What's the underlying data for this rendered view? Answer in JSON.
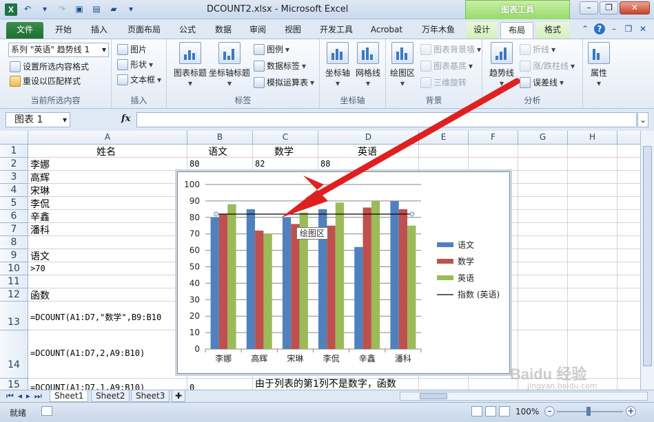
{
  "titlebar": {
    "app_icon": "X",
    "title": "DCOUNT2.xlsx - Microsoft Excel",
    "context_header": "图表工具"
  },
  "tabs": [
    {
      "label": "文件"
    },
    {
      "label": "开始"
    },
    {
      "label": "插入"
    },
    {
      "label": "页面布局"
    },
    {
      "label": "公式"
    },
    {
      "label": "数据"
    },
    {
      "label": "审阅"
    },
    {
      "label": "视图"
    },
    {
      "label": "开发工具"
    },
    {
      "label": "Acrobat"
    },
    {
      "label": "万年木鱼"
    },
    {
      "label": "设计"
    },
    {
      "label": "布局"
    },
    {
      "label": "格式"
    }
  ],
  "ribbon": {
    "current_selection": {
      "selector_value": "系列 \"英语\" 趋势线 1",
      "format_selection": "设置所选内容格式",
      "reset_style": "重设以匹配样式",
      "label": "当前所选内容"
    },
    "insert": {
      "picture": "图片",
      "shapes": "形状",
      "textbox": "文本框",
      "label": "插入"
    },
    "labels": {
      "chart_title": "图表标题",
      "axis_titles": "坐标轴标题",
      "legend": "图例",
      "data_labels": "数据标签",
      "data_table": "模拟运算表",
      "label": "标签"
    },
    "axes": {
      "axes": "坐标轴",
      "gridlines": "网格线",
      "label": "坐标轴"
    },
    "background": {
      "plot_area": "绘图区",
      "chart_wall": "图表背景墙",
      "chart_floor": "图表基底",
      "rotation": "三维旋转",
      "label": "背景"
    },
    "analysis": {
      "trendline": "趋势线",
      "lines": "折线",
      "updown_bars": "涨/跌柱线",
      "error_bars": "误差线",
      "label": "分析"
    },
    "properties": {
      "label": "属性"
    }
  },
  "formula_bar": {
    "name_box": "图表 1",
    "fx": "fx",
    "formula": ""
  },
  "columns": [
    "A",
    "B",
    "C",
    "D",
    "E",
    "F",
    "G",
    "H"
  ],
  "rows": [
    "1",
    "2",
    "3",
    "4",
    "5",
    "6",
    "7",
    "8",
    "9",
    "10",
    "11",
    "12",
    "13",
    "14",
    "15"
  ],
  "cells": {
    "A1": "姓名",
    "B1": "语文",
    "C1": "数学",
    "D1": "英语",
    "A2": "李娜",
    "B2": "80",
    "C2": "82",
    "D2": "88",
    "A3": "高辉",
    "A4": "宋琳",
    "A5": "李侃",
    "A6": "辛鑫",
    "A7": "潘科",
    "A9": "语文",
    "A10": ">70",
    "A12": "函数",
    "A13": "=DCOUNT(A1:D7,\"数学\",B9:B10",
    "A14": "=DCOUNT(A1:D7,2,A9:B10)",
    "A15": "=DCOUNT(A1:D7,1,A9:B10)",
    "B15": "0",
    "C15": "由于列表的第1列不是数字，函数"
  },
  "chart_data": {
    "type": "bar",
    "categories": [
      "李娜",
      "高辉",
      "宋琳",
      "李侃",
      "辛鑫",
      "潘科"
    ],
    "series": [
      {
        "name": "语文",
        "values": [
          80,
          85,
          80,
          85,
          62,
          90
        ],
        "color": "#4f81bd"
      },
      {
        "name": "数学",
        "values": [
          82,
          72,
          76,
          75,
          86,
          85
        ],
        "color": "#c0504d"
      },
      {
        "name": "英语",
        "values": [
          88,
          70,
          83,
          89,
          90,
          75
        ],
        "color": "#9bbb59"
      }
    ],
    "trendline": {
      "name": "指数 (英语)",
      "value": 82,
      "color": "#000000"
    },
    "ylim": [
      0,
      100
    ],
    "yticks": [
      0,
      10,
      20,
      30,
      40,
      50,
      60,
      70,
      80,
      90,
      100
    ],
    "grid": true,
    "legend_position": "right"
  },
  "tooltip": "绘图区",
  "sheets": [
    {
      "label": "Sheet1"
    },
    {
      "label": "Sheet2"
    },
    {
      "label": "Sheet3"
    }
  ],
  "status": {
    "ready": "就绪",
    "zoom": "100%"
  },
  "watermark": {
    "main": "Baidu 经验",
    "sub": "jingyan.baidu.com"
  },
  "colors": {
    "file_tab": "#2a7d3c",
    "context_tab": "#97d96a",
    "accent_arrow": "#e02020"
  }
}
